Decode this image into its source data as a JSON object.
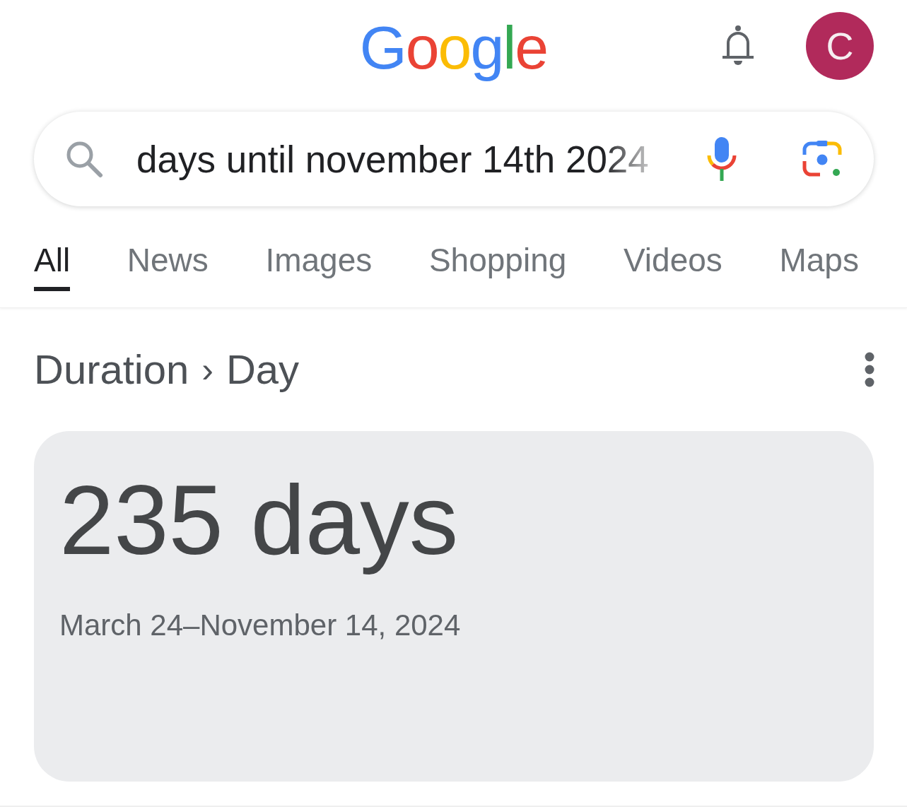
{
  "header": {
    "logo": "Google",
    "avatar": {
      "letter": "C"
    }
  },
  "search": {
    "value": "days until november 14th 2024"
  },
  "tabs": [
    {
      "label": "All",
      "selected": true
    },
    {
      "label": "News",
      "selected": false
    },
    {
      "label": "Images",
      "selected": false
    },
    {
      "label": "Shopping",
      "selected": false
    },
    {
      "label": "Videos",
      "selected": false
    },
    {
      "label": "Maps",
      "selected": false
    }
  ],
  "breadcrumb": {
    "items": [
      "Duration",
      "Day"
    ],
    "separator": "›"
  },
  "result": {
    "value": "235 days",
    "range": "March 24–November 14, 2024"
  }
}
